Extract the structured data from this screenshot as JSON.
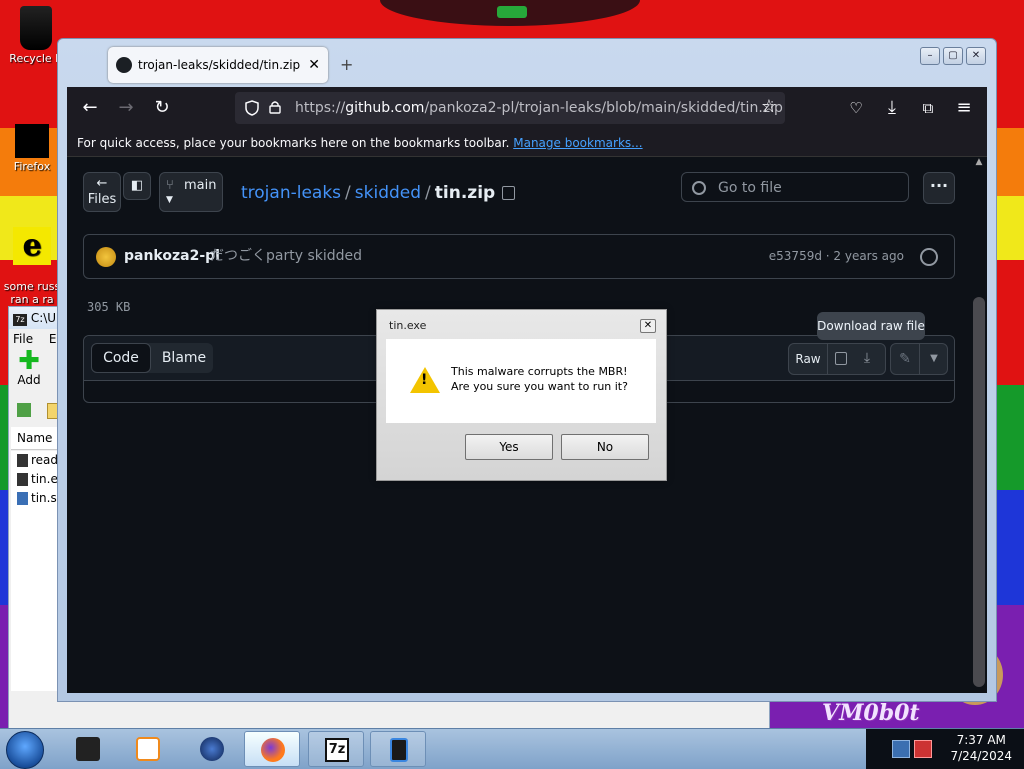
{
  "desktop": {
    "icons": [
      {
        "label": "Recycle B"
      },
      {
        "label": "Firefox"
      },
      {
        "label": "some russ\nran a ra"
      }
    ],
    "watermark": "VM0b0t"
  },
  "sevenzip": {
    "title": "C:\\U",
    "menu": [
      "File",
      "E"
    ],
    "add_label": "Add",
    "column_name": "Name",
    "files": [
      "read",
      "tin.e",
      "tin.s"
    ]
  },
  "browser": {
    "tab_title": "trojan-leaks/skidded/tin.zip at",
    "tab_close": "✕",
    "new_tab": "+",
    "url_prefix": "https://",
    "url_host": "github.com",
    "url_path": "/pankoza2-pl/trojan-leaks/blob/main/skidded/tin.zip",
    "bookmarks_text": "For quick access, place your bookmarks here on the bookmarks toolbar.",
    "bookmarks_link": "Manage bookmarks..."
  },
  "github": {
    "files_label": "Files",
    "branch": "main",
    "breadcrumb": {
      "repo": "trojan-leaks",
      "folder": "skidded",
      "file": "tin.zip"
    },
    "goto_placeholder": "Go to file",
    "more": "···",
    "commit": {
      "author": "pankoza2-pl",
      "message": "だつごくparty skidded",
      "hash_time": "e53759d · 2 years ago"
    },
    "file_size": "305 KB",
    "tabs": {
      "code": "Code",
      "blame": "Blame"
    },
    "raw_label": "Raw",
    "tooltip": "Download raw file"
  },
  "dialog": {
    "title": "tin.exe",
    "close": "✕",
    "message_line1": "This malware corrupts the MBR!",
    "message_line2": "Are you sure you want to run it?",
    "yes_label": "Yes",
    "no_label": "No"
  },
  "taskbar": {
    "time": "7:37 AM",
    "date": "7/24/2024",
    "sevenzip_label": "7z"
  }
}
